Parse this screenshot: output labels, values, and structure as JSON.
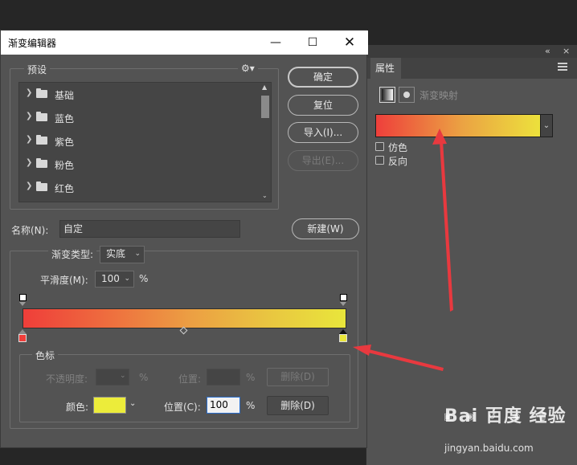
{
  "dialog": {
    "title": "渐变编辑器",
    "presets_label": "预设",
    "preset_items": [
      "基础",
      "蓝色",
      "紫色",
      "粉色",
      "红色"
    ],
    "buttons": {
      "ok": "确定",
      "reset": "复位",
      "import": "导入(I)...",
      "export": "导出(E)...",
      "new": "新建(W)"
    },
    "name_label": "名称(N):",
    "name_value": "自定",
    "gradient_type_label": "渐变类型:",
    "gradient_type_value": "实底",
    "smoothness_label": "平滑度(M):",
    "smoothness_value": "100",
    "percent": "%",
    "stops_group": {
      "label": "色标",
      "opacity_label": "不透明度:",
      "opacity_percent": "%",
      "opacity_location_label": "位置:",
      "opacity_location_percent": "%",
      "opacity_delete": "删除(D)",
      "color_label": "颜色:",
      "color_value": "#ecec3a",
      "color_location_label": "位置(C):",
      "color_location_value": "100",
      "color_location_percent": "%",
      "color_delete": "删除(D)"
    },
    "gradient_colors": [
      "#ef3e3a",
      "#e9e63b"
    ]
  },
  "properties_panel": {
    "tab": "属性",
    "adjustment_title": "渐变映射",
    "dither_label": "仿色",
    "reverse_label": "反向"
  },
  "watermark": {
    "logo": "Bai 百度 经验",
    "url": "jingyan.baidu.com"
  },
  "colors": {
    "annotation_arrow": "#e8393f",
    "panel_bg": "#535353"
  }
}
